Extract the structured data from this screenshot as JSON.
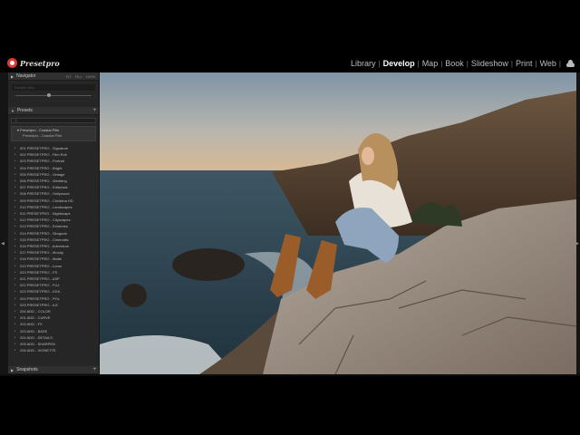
{
  "app": {
    "logo_text": "Presetpro",
    "accent_color": "#e0392f"
  },
  "modules": [
    {
      "label": "Library",
      "active": false
    },
    {
      "label": "Develop",
      "active": true
    },
    {
      "label": "Map",
      "active": false
    },
    {
      "label": "Book",
      "active": false
    },
    {
      "label": "Slideshow",
      "active": false
    },
    {
      "label": "Print",
      "active": false
    },
    {
      "label": "Web",
      "active": false
    }
  ],
  "navigator": {
    "title": "Navigator",
    "options": [
      "FIT",
      "FILL",
      "100%"
    ],
    "preview_text": "Double click"
  },
  "presets": {
    "title": "Presets",
    "add_icon": "+",
    "filter_placeholder": "Q",
    "group_title": "Presetpro - Coastal Film",
    "group_subtitle": "Presetpro - Coastal Film",
    "items": [
      "001 PRESETPRO - Signature",
      "002 PRESETPRO - Film Roll",
      "003 PRESETPRO - Portrait",
      "004 PRESETPRO - Bright",
      "005 PRESETPRO - Vintage",
      "006 PRESETPRO - Wedding",
      "007 PRESETPRO - Editorials",
      "008 PRESETPRO - Hollywood",
      "009 PRESETPRO - Christina HD",
      "010 PRESETPRO - Landscapes",
      "011 PRESETPRO - Nightscape",
      "012 PRESETPRO - Cityscapes",
      "013 PRESETPRO - Extremes",
      "014 PRESETPRO - Skogsvis",
      "015 PRESETPRO - Cinematic",
      "016 PRESETPRO - Adventure",
      "017 PRESETPRO - Moody",
      "018 PRESETPRO - Matte",
      "019 PRESETPRO - Lomo",
      "020 PRESETPRO - FS",
      "021 PRESETPRO - ASP",
      "022 PRESETPRO - FUJ",
      "023 PRESETPRO - KDK",
      "024 PRESETPRO - POL",
      "025 PRESETPRO - ILE",
      "200 ADD - COLOR",
      "201 ADD - CURVE",
      "202 ADD - FX",
      "203 ADD - BASE",
      "204 ADD - DETAILS",
      "205 ADD - SHARPEN",
      "206 ADD - VIGNETTE"
    ]
  },
  "snapshots": {
    "title": "Snapshots",
    "add_icon": "+"
  }
}
